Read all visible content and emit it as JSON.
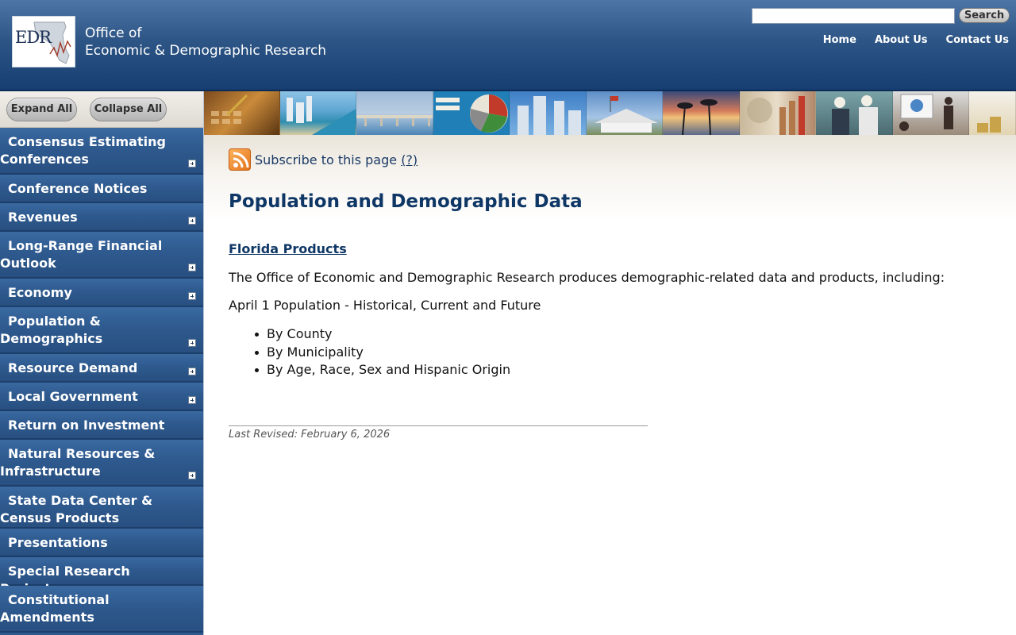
{
  "header": {
    "logo_text": "EDR",
    "title_line1": "Office of",
    "title_line2": "Economic & Demographic Research",
    "search_placeholder": "",
    "search_button": "Search",
    "nav": [
      "Home",
      "About Us",
      "Contact Us"
    ]
  },
  "sidebar": {
    "expand_all": "Expand All",
    "collapse_all": "Collapse All",
    "items": [
      {
        "label": "Consensus Estimating Conferences",
        "expandable": true
      },
      {
        "label": "Conference Notices",
        "expandable": false
      },
      {
        "label": "Revenues",
        "expandable": true
      },
      {
        "label": "Long-Range Financial Outlook",
        "expandable": true
      },
      {
        "label": "Economy",
        "expandable": true
      },
      {
        "label": "Population & Demographics",
        "expandable": true
      },
      {
        "label": "Resource Demand",
        "expandable": true
      },
      {
        "label": "Local Government",
        "expandable": true
      },
      {
        "label": "Return on Investment",
        "expandable": false
      },
      {
        "label": "Natural Resources & Infrastructure",
        "expandable": true
      },
      {
        "label": "State Data Center & Census Products",
        "expandable": false
      },
      {
        "label": "Presentations",
        "expandable": false
      },
      {
        "label": "Special Research Projects",
        "expandable": false
      },
      {
        "label": "Constitutional Amendments",
        "expandable": false
      }
    ]
  },
  "content": {
    "subscribe_text": "Subscribe to this page",
    "subscribe_help": "(?)",
    "title": "Population and Demographic Data",
    "section_link": "Florida Products",
    "intro": "The Office of Economic and Demographic Research produces demographic-related data and products, including:",
    "subheading": "April 1 Population - Historical, Current and Future",
    "bullets": [
      "By County",
      "By Municipality",
      "By Age, Race, Sex and Hispanic Origin"
    ],
    "last_revised": "Last Revised: February 6, 2026"
  },
  "colors": {
    "header_blue": "#2d5585",
    "nav_blue": "#2f5b90",
    "title_blue": "#0f3766",
    "rss_orange": "#e4741d"
  }
}
